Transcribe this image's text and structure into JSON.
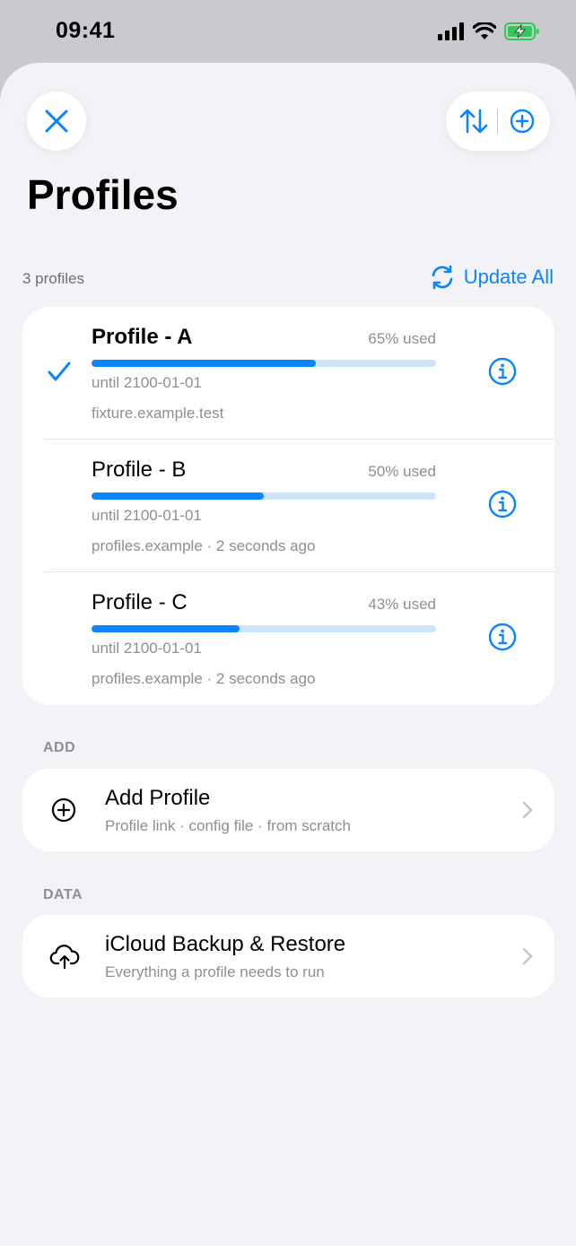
{
  "status_bar": {
    "time": "09:41"
  },
  "header": {
    "title": "Profiles"
  },
  "list_header": {
    "count": "3 profiles",
    "update_all": "Update All"
  },
  "profiles": [
    {
      "name": "Profile - A",
      "used": "65% used",
      "used_fraction": 0.65,
      "until": "until 2100-01-01",
      "source": "fixture.example.test",
      "selected": true
    },
    {
      "name": "Profile - B",
      "used": "50% used",
      "used_fraction": 0.5,
      "until": "until 2100-01-01",
      "source": "profiles.example · 2 seconds ago",
      "selected": false
    },
    {
      "name": "Profile - C",
      "used": "43% used",
      "used_fraction": 0.43,
      "until": "until 2100-01-01",
      "source": "profiles.example · 2 seconds ago",
      "selected": false
    }
  ],
  "add_section": {
    "header": "ADD",
    "title": "Add Profile",
    "subtitle": "Profile link · config file · from scratch",
    "icon": "plus-circle-icon"
  },
  "data_section": {
    "header": "DATA",
    "title": "iCloud Backup & Restore",
    "subtitle": "Everything a profile needs to run",
    "icon": "cloud-upload-icon"
  },
  "colors": {
    "accent": "#0a84ff",
    "background": "#f2f2f7",
    "battery": "#34c759"
  }
}
